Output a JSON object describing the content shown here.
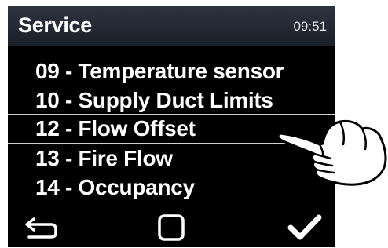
{
  "header": {
    "title": "Service",
    "time": "09:51"
  },
  "menu": {
    "items": [
      {
        "label": "09 - Temperature sensor",
        "selected": false
      },
      {
        "label": "10 - Supply Duct Limits",
        "selected": false
      },
      {
        "label": "12 - Flow Offset",
        "selected": true
      },
      {
        "label": "13 - Fire Flow",
        "selected": false
      },
      {
        "label": "14 - Occupancy",
        "selected": false
      }
    ]
  },
  "bottombar": {
    "back_icon": "back-arrow-icon",
    "home_icon": "square-home-icon",
    "ok_icon": "checkmark-icon"
  },
  "overlay": {
    "pointer_icon": "pointing-hand-icon"
  }
}
